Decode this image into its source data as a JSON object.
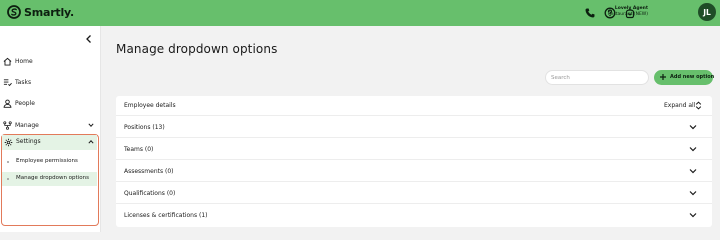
{
  "app": {
    "logo_text": "Smartly.",
    "brand_color": "#67bf6c"
  },
  "header": {
    "icons": [
      "phone-icon",
      "help-icon",
      "notification-icon"
    ],
    "user": {
      "name": "Lovely Agent",
      "role": "Restaurant (NEW)",
      "initials": "JL"
    }
  },
  "sidebar": {
    "items": [
      {
        "label": "Home",
        "icon": "home-icon"
      },
      {
        "label": "Tasks",
        "icon": "tasks-icon"
      },
      {
        "label": "People",
        "icon": "people-icon"
      },
      {
        "label": "Manage",
        "icon": "manage-icon"
      },
      {
        "label": "Settings",
        "icon": "settings-icon"
      }
    ],
    "settings_children": [
      {
        "label": "Employee permissions",
        "active": false
      },
      {
        "label": "Manage dropdown options",
        "active": true
      }
    ]
  },
  "main": {
    "title": "Manage dropdown options",
    "search": {
      "placeholder": "Search",
      "value": ""
    },
    "add_button_label": "Add new option",
    "card": {
      "header_label": "Employee details",
      "expand_label": "Expand all",
      "rows": [
        {
          "label": "Positions (13)"
        },
        {
          "label": "Teams (0)"
        },
        {
          "label": "Assessments (0)"
        },
        {
          "label": "Qualifications (0)"
        },
        {
          "label": "Licenses & certifications (1)"
        }
      ]
    }
  }
}
